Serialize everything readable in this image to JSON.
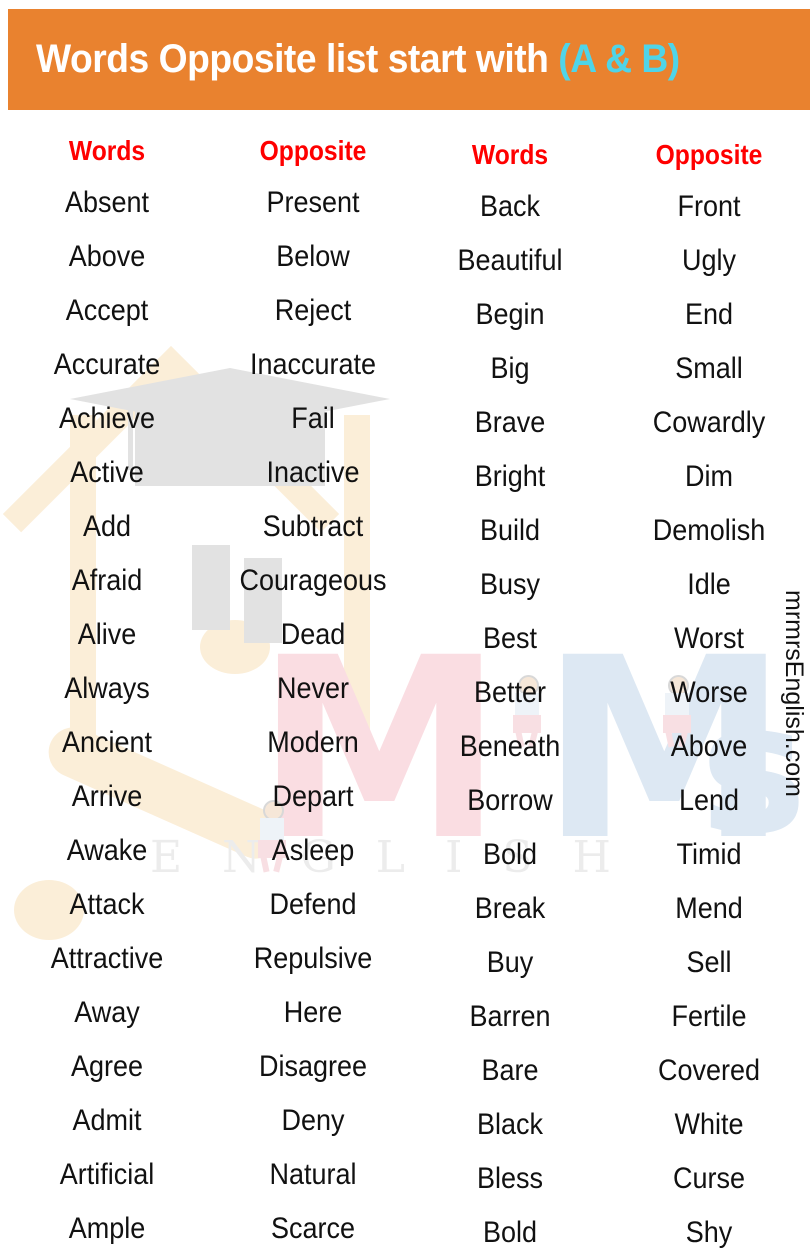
{
  "header": {
    "title_main": "Words Opposite list start with ",
    "title_accent": "(A & B)",
    "background_color": "#e9822f",
    "accent_color": "#4fd4e8",
    "text_color": "#ffffff"
  },
  "watermark": {
    "site_credit": "mrmrsEnglish.com",
    "logo_letter_left": "M",
    "logo_letter_right": "M",
    "logo_letter_s": "s",
    "english_text": "ENGLISH",
    "heading_color": "#ff0000"
  },
  "columns": {
    "words_label": "Words",
    "opposite_label": "Opposite"
  },
  "table": {
    "left_pairs": [
      {
        "word": "Absent",
        "opposite": "Present"
      },
      {
        "word": "Above",
        "opposite": "Below"
      },
      {
        "word": "Accept",
        "opposite": "Reject"
      },
      {
        "word": "Accurate",
        "opposite": "Inaccurate"
      },
      {
        "word": "Achieve",
        "opposite": "Fail"
      },
      {
        "word": "Active",
        "opposite": "Inactive"
      },
      {
        "word": "Add",
        "opposite": "Subtract"
      },
      {
        "word": "Afraid",
        "opposite": "Courageous"
      },
      {
        "word": "Alive",
        "opposite": "Dead"
      },
      {
        "word": "Always",
        "opposite": "Never"
      },
      {
        "word": "Ancient",
        "opposite": "Modern"
      },
      {
        "word": "Arrive",
        "opposite": "Depart"
      },
      {
        "word": "Awake",
        "opposite": "Asleep"
      },
      {
        "word": "Attack",
        "opposite": "Defend"
      },
      {
        "word": "Attractive",
        "opposite": "Repulsive"
      },
      {
        "word": "Away",
        "opposite": "Here"
      },
      {
        "word": "Agree",
        "opposite": "Disagree"
      },
      {
        "word": "Admit",
        "opposite": "Deny"
      },
      {
        "word": "Artificial",
        "opposite": "Natural"
      },
      {
        "word": "Ample",
        "opposite": "Scarce"
      }
    ],
    "right_pairs": [
      {
        "word": "Back",
        "opposite": "Front"
      },
      {
        "word": "Beautiful",
        "opposite": "Ugly"
      },
      {
        "word": "Begin",
        "opposite": "End"
      },
      {
        "word": "Big",
        "opposite": "Small"
      },
      {
        "word": "Brave",
        "opposite": "Cowardly"
      },
      {
        "word": "Bright",
        "opposite": "Dim"
      },
      {
        "word": "Build",
        "opposite": "Demolish"
      },
      {
        "word": "Busy",
        "opposite": "Idle"
      },
      {
        "word": "Best",
        "opposite": "Worst"
      },
      {
        "word": "Better",
        "opposite": "Worse"
      },
      {
        "word": "Beneath",
        "opposite": "Above"
      },
      {
        "word": "Borrow",
        "opposite": "Lend"
      },
      {
        "word": "Bold",
        "opposite": "Timid"
      },
      {
        "word": "Break",
        "opposite": "Mend"
      },
      {
        "word": "Buy",
        "opposite": "Sell"
      },
      {
        "word": "Barren",
        "opposite": "Fertile"
      },
      {
        "word": "Bare",
        "opposite": "Covered"
      },
      {
        "word": "Black",
        "opposite": "White"
      },
      {
        "word": "Bless",
        "opposite": "Curse"
      },
      {
        "word": "Bold",
        "opposite": "Shy"
      }
    ]
  }
}
